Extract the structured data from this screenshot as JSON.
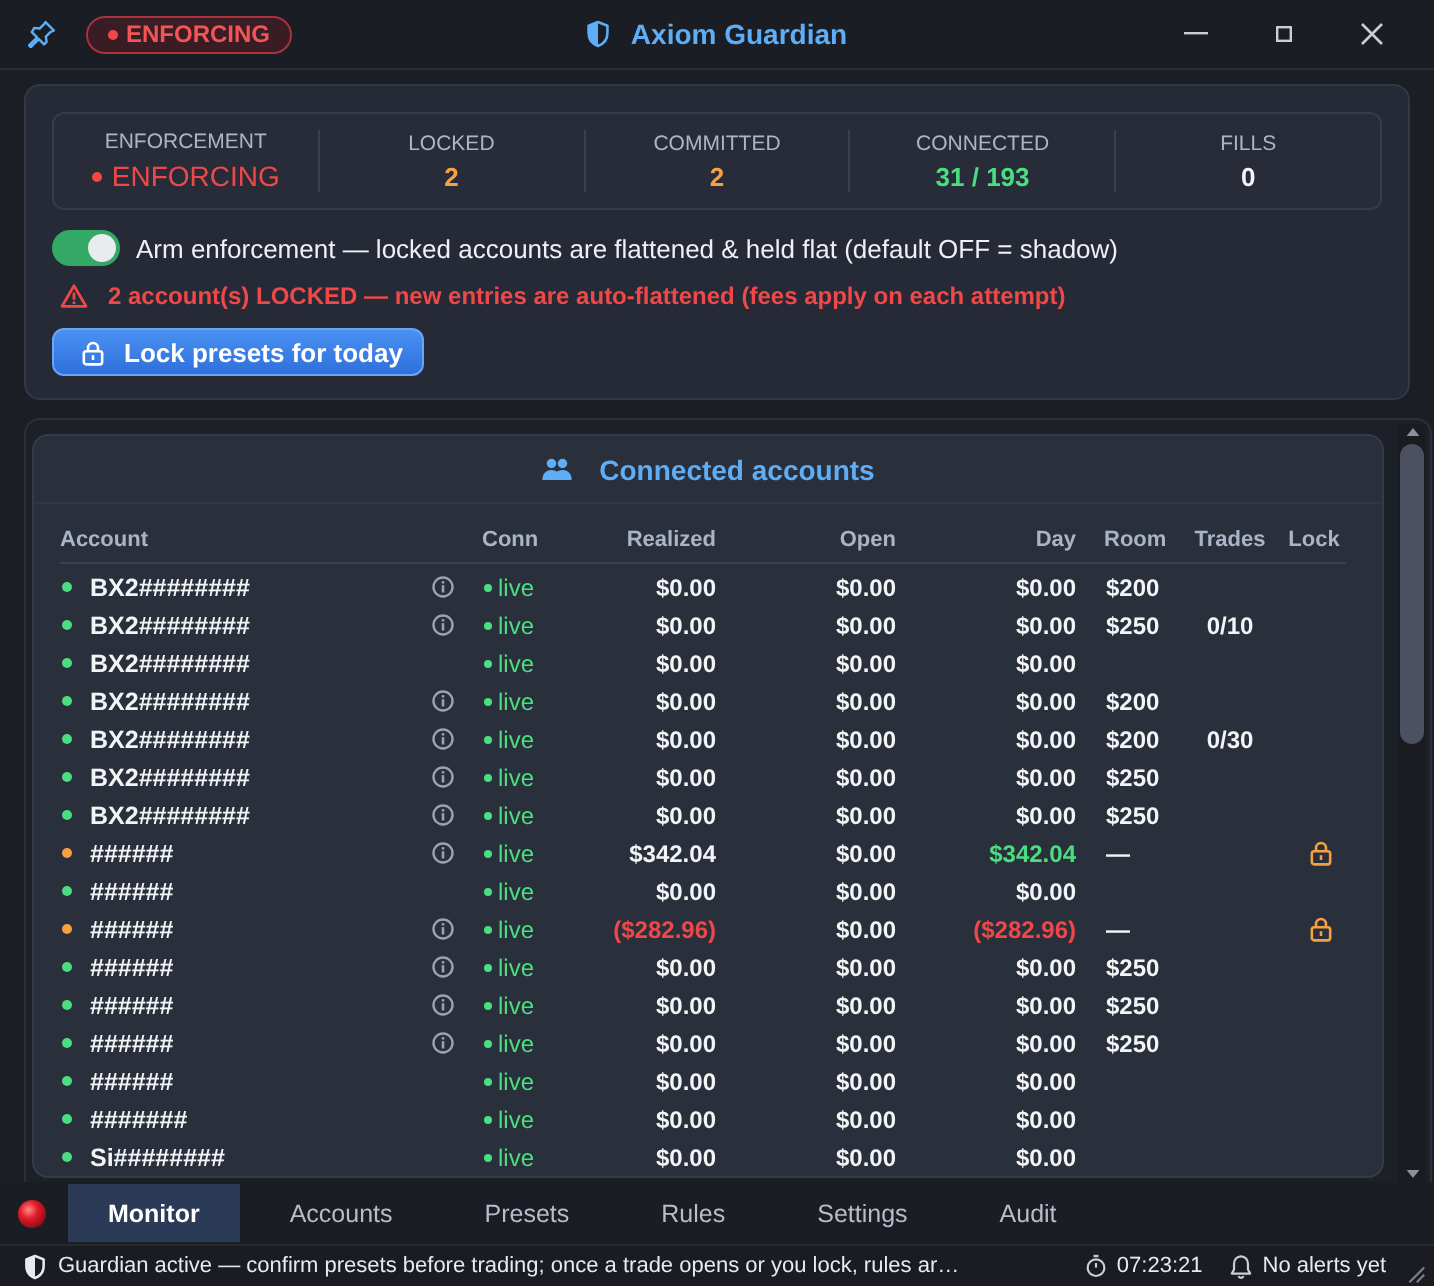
{
  "title_bar": {
    "badge": "ENFORCING",
    "title": "Axiom Guardian"
  },
  "summary": {
    "stats": [
      {
        "label": "ENFORCEMENT",
        "value": "ENFORCING",
        "color": "#f04848",
        "dot": true
      },
      {
        "label": "LOCKED",
        "value": "2",
        "color": "#f5a142",
        "dot": false
      },
      {
        "label": "COMMITTED",
        "value": "2",
        "color": "#f5a142",
        "dot": false
      },
      {
        "label": "CONNECTED",
        "value": "31 / 193",
        "color": "#4ade80",
        "dot": false
      },
      {
        "label": "FILLS",
        "value": "0",
        "color": "#f3f4f6",
        "dot": false
      }
    ]
  },
  "enforcement_toggle": {
    "label": "Arm enforcement — locked accounts are flattened & held flat (default OFF = shadow)",
    "on": true
  },
  "warning": "2 account(s) LOCKED — new entries are auto-flattened (fees apply on each attempt)",
  "lock_button": "Lock presets for today",
  "accounts": {
    "title": "Connected accounts",
    "columns": [
      "Account",
      "Conn",
      "Realized",
      "Open",
      "Day",
      "Room",
      "Trades",
      "Lock"
    ],
    "rows": [
      {
        "color": "#4ade80",
        "account": "BX2########",
        "info": true,
        "conn": "live",
        "realized": {
          "text": "$0.00",
          "color": "#f3f4f6"
        },
        "open": "$0.00",
        "day": {
          "text": "$0.00",
          "color": "#f3f4f6"
        },
        "room": "$200",
        "locked": false
      },
      {
        "color": "#4ade80",
        "account": "BX2########",
        "info": true,
        "conn": "live",
        "realized": {
          "text": "$0.00",
          "color": "#f3f4f6"
        },
        "open": "$0.00",
        "day": {
          "text": "$0.00",
          "color": "#f3f4f6"
        },
        "room": "$250",
        "trades": "0/10",
        "locked": false
      },
      {
        "color": "#4ade80",
        "account": "BX2########",
        "info": false,
        "conn": "live",
        "realized": {
          "text": "$0.00",
          "color": "#f3f4f6"
        },
        "open": "$0.00",
        "day": {
          "text": "$0.00",
          "color": "#f3f4f6"
        },
        "locked": false
      },
      {
        "color": "#4ade80",
        "account": "BX2########",
        "info": true,
        "conn": "live",
        "realized": {
          "text": "$0.00",
          "color": "#f3f4f6"
        },
        "open": "$0.00",
        "day": {
          "text": "$0.00",
          "color": "#f3f4f6"
        },
        "room": "$200",
        "locked": false
      },
      {
        "color": "#4ade80",
        "account": "BX2########",
        "info": true,
        "conn": "live",
        "realized": {
          "text": "$0.00",
          "color": "#f3f4f6"
        },
        "open": "$0.00",
        "day": {
          "text": "$0.00",
          "color": "#f3f4f6"
        },
        "room": "$200",
        "trades": "0/30",
        "locked": false
      },
      {
        "color": "#4ade80",
        "account": "BX2########",
        "info": true,
        "conn": "live",
        "realized": {
          "text": "$0.00",
          "color": "#f3f4f6"
        },
        "open": "$0.00",
        "day": {
          "text": "$0.00",
          "color": "#f3f4f6"
        },
        "room": "$250",
        "locked": false
      },
      {
        "color": "#4ade80",
        "account": "BX2########",
        "info": true,
        "conn": "live",
        "realized": {
          "text": "$0.00",
          "color": "#f3f4f6"
        },
        "open": "$0.00",
        "day": {
          "text": "$0.00",
          "color": "#f3f4f6"
        },
        "room": "$250",
        "locked": false
      },
      {
        "color": "#f5a142",
        "account": "######",
        "info": true,
        "conn": "live",
        "realized": {
          "text": "$342.04",
          "color": "#f3f4f6"
        },
        "open": "$0.00",
        "day": {
          "text": "$342.04",
          "color": "#4ade80"
        },
        "room": "—",
        "locked": true
      },
      {
        "color": "#4ade80",
        "account": "######",
        "info": false,
        "conn": "live",
        "realized": {
          "text": "$0.00",
          "color": "#f3f4f6"
        },
        "open": "$0.00",
        "day": {
          "text": "$0.00",
          "color": "#f3f4f6"
        },
        "locked": false
      },
      {
        "color": "#f5a142",
        "account": "######",
        "info": true,
        "conn": "live",
        "realized": {
          "text": "($282.96)",
          "color": "#f04848"
        },
        "open": "$0.00",
        "day": {
          "text": "($282.96)",
          "color": "#f04848"
        },
        "room": "—",
        "locked": true
      },
      {
        "color": "#4ade80",
        "account": "######",
        "info": true,
        "conn": "live",
        "realized": {
          "text": "$0.00",
          "color": "#f3f4f6"
        },
        "open": "$0.00",
        "day": {
          "text": "$0.00",
          "color": "#f3f4f6"
        },
        "room": "$250",
        "locked": false
      },
      {
        "color": "#4ade80",
        "account": "######",
        "info": true,
        "conn": "live",
        "realized": {
          "text": "$0.00",
          "color": "#f3f4f6"
        },
        "open": "$0.00",
        "day": {
          "text": "$0.00",
          "color": "#f3f4f6"
        },
        "room": "$250",
        "locked": false
      },
      {
        "color": "#4ade80",
        "account": "######",
        "info": true,
        "conn": "live",
        "realized": {
          "text": "$0.00",
          "color": "#f3f4f6"
        },
        "open": "$0.00",
        "day": {
          "text": "$0.00",
          "color": "#f3f4f6"
        },
        "room": "$250",
        "locked": false
      },
      {
        "color": "#4ade80",
        "account": "######",
        "info": false,
        "conn": "live",
        "realized": {
          "text": "$0.00",
          "color": "#f3f4f6"
        },
        "open": "$0.00",
        "day": {
          "text": "$0.00",
          "color": "#f3f4f6"
        },
        "locked": false
      },
      {
        "color": "#4ade80",
        "account": "#######",
        "info": false,
        "conn": "live",
        "realized": {
          "text": "$0.00",
          "color": "#f3f4f6"
        },
        "open": "$0.00",
        "day": {
          "text": "$0.00",
          "color": "#f3f4f6"
        },
        "locked": false
      },
      {
        "color": "#4ade80",
        "account": "Si########",
        "info": false,
        "conn": "live",
        "realized": {
          "text": "$0.00",
          "color": "#f3f4f6"
        },
        "open": "$0.00",
        "day": {
          "text": "$0.00",
          "color": "#f3f4f6"
        },
        "locked": false
      }
    ]
  },
  "tabs": [
    {
      "label": "Monitor",
      "selected": true
    },
    {
      "label": "Accounts",
      "selected": false
    },
    {
      "label": "Presets",
      "selected": false
    },
    {
      "label": "Rules",
      "selected": false
    },
    {
      "label": "Settings",
      "selected": false
    },
    {
      "label": "Audit",
      "selected": false
    }
  ],
  "status_bar": {
    "message": "Guardian active — confirm presets before trading; once a trade opens or you lock, rules ar…",
    "timer": "07:23:21",
    "alerts": "No alerts yet"
  }
}
